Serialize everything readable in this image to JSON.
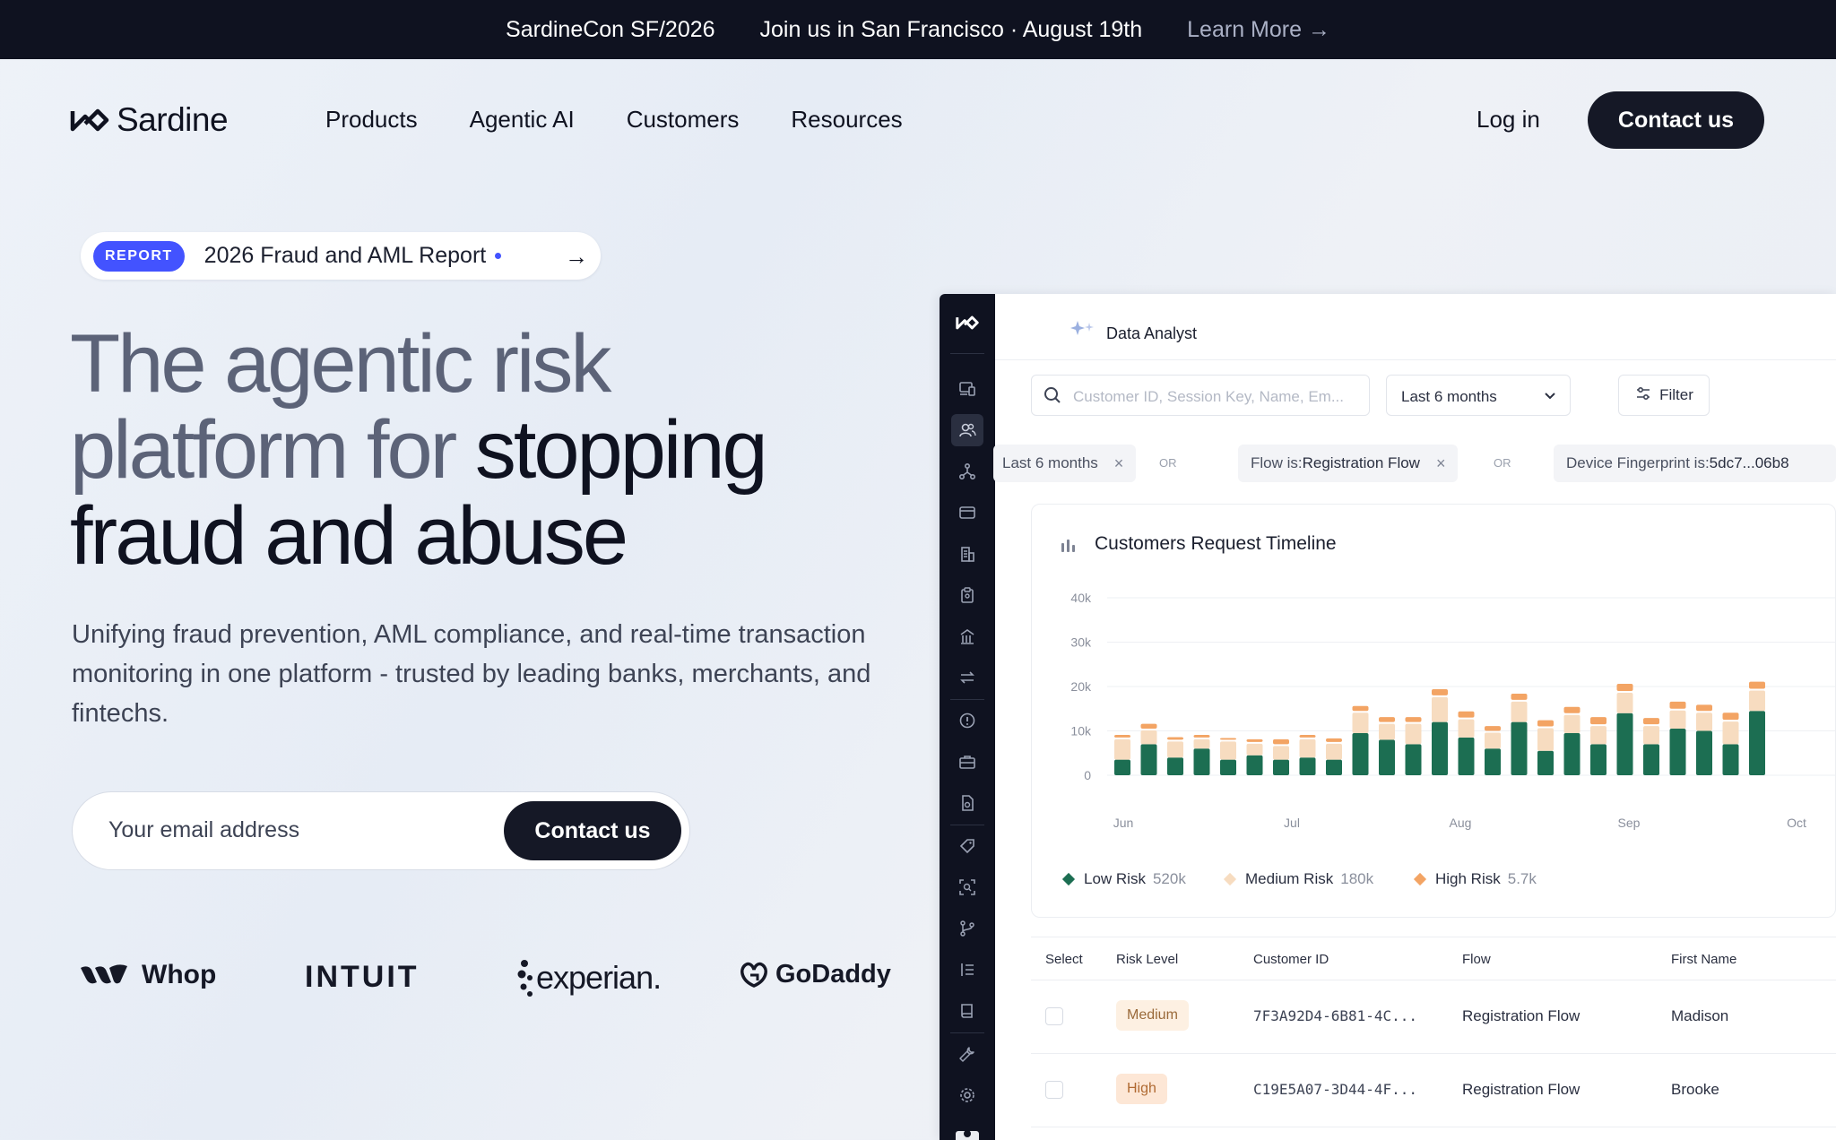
{
  "announcement": {
    "event": "SardineCon SF/2026",
    "message": "Join us in San Francisco · August 19th",
    "link_label": "Learn More →"
  },
  "nav": {
    "brand": "Sardine",
    "items": [
      "Products",
      "Agentic AI",
      "Customers",
      "Resources"
    ],
    "login": "Log in",
    "contact": "Contact us"
  },
  "report": {
    "badge": "REPORT",
    "text": "2026 Fraud and AML Report",
    "arrow": "→"
  },
  "hero": {
    "title_light": "The agentic risk platform for",
    "title_dark": "stopping fraud and abuse",
    "subtitle": "Unifying fraud prevention, AML compliance, and real-time transaction monitoring in one platform - trusted by leading banks, merchants, and fintechs.",
    "email_placeholder": "Your email address",
    "cta": "Contact us"
  },
  "customer_logos": [
    "Whop",
    "INTUIT",
    "experian.",
    "GoDaddy"
  ],
  "dashboard": {
    "header_title": "Data Analyst",
    "search_placeholder": "Customer ID, Session Key, Name, Em...",
    "range": "Last 6 months",
    "filter_label": "Filter",
    "chips": [
      {
        "label": "Last 6 months",
        "value": ""
      },
      {
        "label": "Flow is: ",
        "value": "Registration Flow"
      },
      {
        "label": "Device Fingerprint is: ",
        "value": "5dc7...06b8"
      }
    ],
    "or_label": "OR",
    "chart_title": "Customers Request Timeline",
    "legend": [
      {
        "name": "Low Risk",
        "value": "520k",
        "color": "#1c6e52"
      },
      {
        "name": "Medium Risk",
        "value": "180k",
        "color": "#f7dcc0"
      },
      {
        "name": "High Risk",
        "value": "5.7k",
        "color": "#f3a464"
      }
    ],
    "table": {
      "columns": [
        "Select",
        "Risk Level",
        "Customer ID",
        "Flow",
        "First Name"
      ],
      "rows": [
        {
          "risk": "Medium",
          "customer_id": "7F3A92D4-6B81-4C...",
          "flow": "Registration Flow",
          "first_name": "Madison"
        },
        {
          "risk": "High",
          "customer_id": "C19E5A07-3D44-4F...",
          "flow": "Registration Flow",
          "first_name": "Brooke"
        }
      ]
    }
  },
  "chart_data": {
    "type": "bar",
    "title": "Customers Request Timeline",
    "x_ticks": [
      "Jun",
      "Jul",
      "Aug",
      "Sep",
      "Oct"
    ],
    "y_ticks": [
      "0",
      "10k",
      "20k",
      "30k",
      "40k"
    ],
    "ylim": [
      0,
      40000
    ],
    "stacked": true,
    "series": [
      {
        "name": "Low Risk",
        "color": "#1c6e52",
        "values": [
          3500,
          7000,
          4000,
          6000,
          3500,
          4500,
          3500,
          4000,
          3500,
          9500,
          8000,
          7000,
          12000,
          8500,
          6000,
          12000,
          5500,
          9500,
          7000,
          14000,
          7000,
          10500,
          10000,
          7000,
          14500
        ]
      },
      {
        "name": "Medium Risk",
        "color": "#f7dcc0",
        "values": [
          5000,
          3500,
          4000,
          2500,
          4500,
          3000,
          3500,
          4500,
          4000,
          5000,
          4000,
          5000,
          6000,
          4500,
          4000,
          5000,
          5500,
          4500,
          4500,
          5000,
          4500,
          4500,
          4500,
          5500,
          5000
        ]
      },
      {
        "name": "High Risk",
        "color": "#f3a464",
        "values": [
          1000,
          1500,
          1000,
          1000,
          800,
          1000,
          1500,
          1000,
          1200,
          1500,
          1500,
          1500,
          1800,
          1800,
          1500,
          1800,
          1800,
          1800,
          2000,
          2000,
          1800,
          2000,
          1800,
          2000,
          2000
        ]
      }
    ]
  }
}
